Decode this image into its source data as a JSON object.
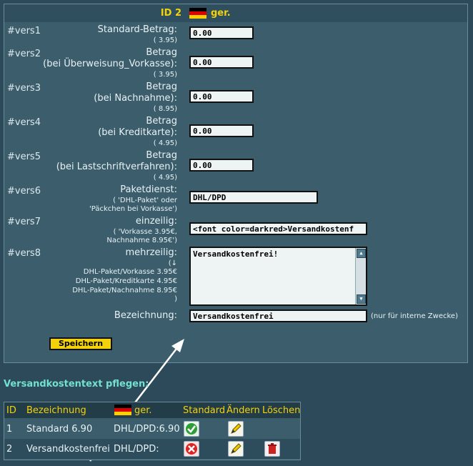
{
  "header": {
    "id_label": "ID 2",
    "lang_label": "ger."
  },
  "rows": [
    {
      "id": "#vers1",
      "label": [
        "Standard-Betrag:"
      ],
      "hint": [
        "( 3.95)"
      ],
      "value": "0.00"
    },
    {
      "id": "#vers2",
      "label": [
        "Betrag",
        "(bei Überweisung_Vorkasse):"
      ],
      "hint": [
        "( 3.95)"
      ],
      "value": "0.00"
    },
    {
      "id": "#vers3",
      "label": [
        "Betrag",
        "(bei Nachnahme):"
      ],
      "hint": [
        "( 8.95)"
      ],
      "value": "0.00"
    },
    {
      "id": "#vers4",
      "label": [
        "Betrag",
        "(bei Kreditkarte):"
      ],
      "hint": [
        "( 4.95)"
      ],
      "value": "0.00"
    },
    {
      "id": "#vers5",
      "label": [
        "Betrag",
        "(bei Lastschriftverfahren):"
      ],
      "hint": [
        "( 4.95)"
      ],
      "value": "0.00"
    },
    {
      "id": "#vers6",
      "label": [
        "Paketdienst:"
      ],
      "hint": [
        "( 'DHL-Paket' oder",
        "'Päckchen bei Vorkasse')"
      ],
      "value": "DHL/DPD"
    },
    {
      "id": "#vers7",
      "label": [
        "einzeilig:"
      ],
      "hint": [
        "( 'Vorkasse 3.95€,",
        "Nachnahme 8.95€')"
      ],
      "value": "<font color=darkred>Versandkostenf"
    },
    {
      "id": "#vers8",
      "label": [
        "mehrzeilig:"
      ],
      "hint": [
        "(↓",
        "DHL-Paket/Vorkasse 3.95€",
        "DHL-Paket/Kreditkarte 4.95€",
        "DHL-Paket/Nachnahme 8.95€",
        ")"
      ],
      "value": "Versandkostenfrei!"
    }
  ],
  "bezeichnung": {
    "label": "Bezeichnung:",
    "value": "Versandkostenfrei",
    "note": "(nur für interne Zwecke)"
  },
  "save_label": "Speichern",
  "section_title": "Versandkostentext pflegen:",
  "table": {
    "headers": {
      "id": "ID",
      "name": "Bezeichnung",
      "lang": "ger.",
      "standard": "Standard",
      "edit": "Ändern",
      "delete": "Löschen"
    },
    "rows": [
      {
        "id": "1",
        "name": "Standard 6.90",
        "lang": "DHL/DPD:6.90"
      },
      {
        "id": "2",
        "name": "Versandkostenfrei",
        "lang": "DHL/DPD:"
      }
    ]
  },
  "colors": {
    "accent": "#f3d20c",
    "panel": "#3b5d6c",
    "background": "#2c4a5a",
    "section_title": "#74e0d0"
  }
}
